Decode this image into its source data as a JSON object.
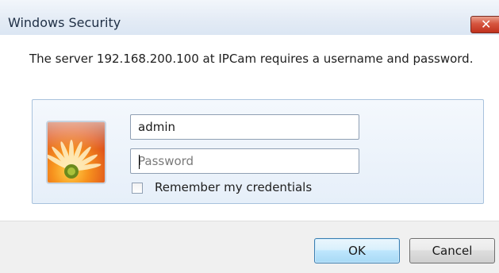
{
  "window": {
    "title": "Windows Security",
    "close_label": "✕"
  },
  "message": "The server 192.168.200.100 at IPCam requires a username and password.",
  "credentials": {
    "username_value": "admin",
    "password_placeholder": "Password",
    "remember_label": "Remember my credentials",
    "remember_checked": false
  },
  "buttons": {
    "ok_label": "OK",
    "cancel_label": "Cancel"
  },
  "colors": {
    "accent": "#3c7fb1",
    "close_red": "#c0311d",
    "panel_bg": "#e6eff9"
  },
  "icons": {
    "avatar": "user-tile-flower-icon",
    "close": "close-icon"
  }
}
